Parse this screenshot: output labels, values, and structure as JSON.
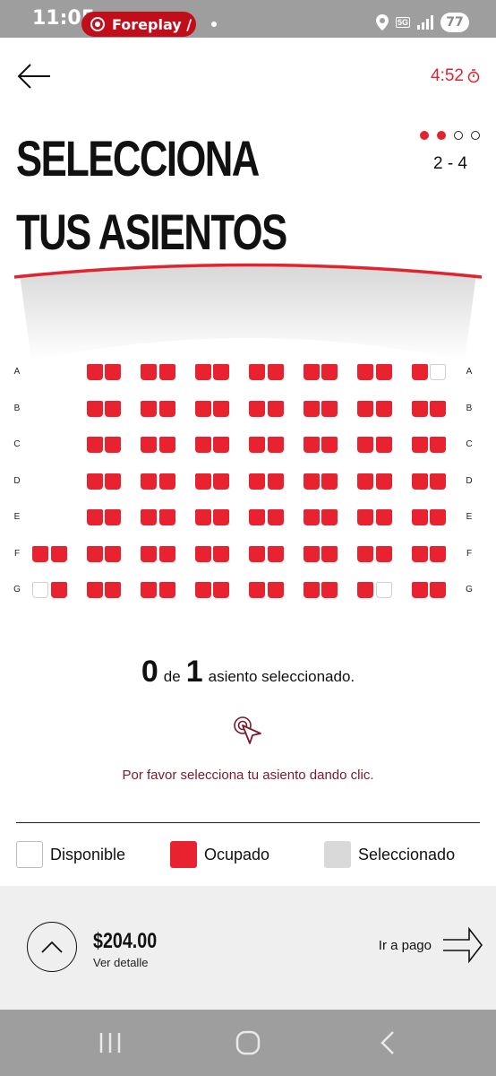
{
  "status_bar": {
    "time": "11:05",
    "notification_app": "Foreplay /",
    "network": "5G",
    "battery": "77"
  },
  "header": {
    "timer": "4:52",
    "title": "SELECCIONA TUS ASIENTOS",
    "step_label": "2 - 4",
    "steps_total": 4,
    "steps_done": 2
  },
  "seat_map": {
    "rows": [
      "A",
      "B",
      "C",
      "D",
      "E",
      "F",
      "G"
    ],
    "blocks": 8,
    "seats_per_block": 2,
    "layout": [
      [
        "",
        "",
        "occupied",
        "occupied",
        "occupied",
        "occupied",
        "occupied",
        "occupied",
        "occupied",
        "occupied",
        "occupied",
        "occupied",
        "occupied",
        "occupied",
        "occupied",
        "available"
      ],
      [
        "",
        "",
        "occupied",
        "occupied",
        "occupied",
        "occupied",
        "occupied",
        "occupied",
        "occupied",
        "occupied",
        "occupied",
        "occupied",
        "occupied",
        "occupied",
        "occupied",
        "occupied"
      ],
      [
        "",
        "",
        "occupied",
        "occupied",
        "occupied",
        "occupied",
        "occupied",
        "occupied",
        "occupied",
        "occupied",
        "occupied",
        "occupied",
        "occupied",
        "occupied",
        "occupied",
        "occupied"
      ],
      [
        "",
        "",
        "occupied",
        "occupied",
        "occupied",
        "occupied",
        "occupied",
        "occupied",
        "occupied",
        "occupied",
        "occupied",
        "occupied",
        "occupied",
        "occupied",
        "occupied",
        "occupied"
      ],
      [
        "",
        "",
        "occupied",
        "occupied",
        "occupied",
        "occupied",
        "occupied",
        "occupied",
        "occupied",
        "occupied",
        "occupied",
        "occupied",
        "occupied",
        "occupied",
        "occupied",
        "occupied"
      ],
      [
        "occupied",
        "occupied",
        "occupied",
        "occupied",
        "occupied",
        "occupied",
        "occupied",
        "occupied",
        "occupied",
        "occupied",
        "occupied",
        "occupied",
        "occupied",
        "occupied",
        "occupied",
        "occupied"
      ],
      [
        "available",
        "occupied",
        "occupied",
        "occupied",
        "occupied",
        "occupied",
        "occupied",
        "occupied",
        "occupied",
        "occupied",
        "occupied",
        "occupied",
        "occupied",
        "available",
        "occupied",
        "occupied"
      ]
    ]
  },
  "selection": {
    "selected_count": "0",
    "of_word": "de",
    "max_count": "1",
    "suffix": "asiento seleccionado.",
    "hint": "Por favor selecciona tu asiento dando clic."
  },
  "legend": {
    "available": "Disponible",
    "occupied": "Ocupado",
    "selected": "Seleccionado"
  },
  "footer": {
    "price": "$204.00",
    "detail_link": "Ver detalle",
    "pay_label": "Ir a pago"
  },
  "colors": {
    "accent": "#e02530",
    "occupied": "#e8232f",
    "selected": "#d9d9d9",
    "hint": "#7a1a2a",
    "system_bar": "#9e9e9e"
  }
}
